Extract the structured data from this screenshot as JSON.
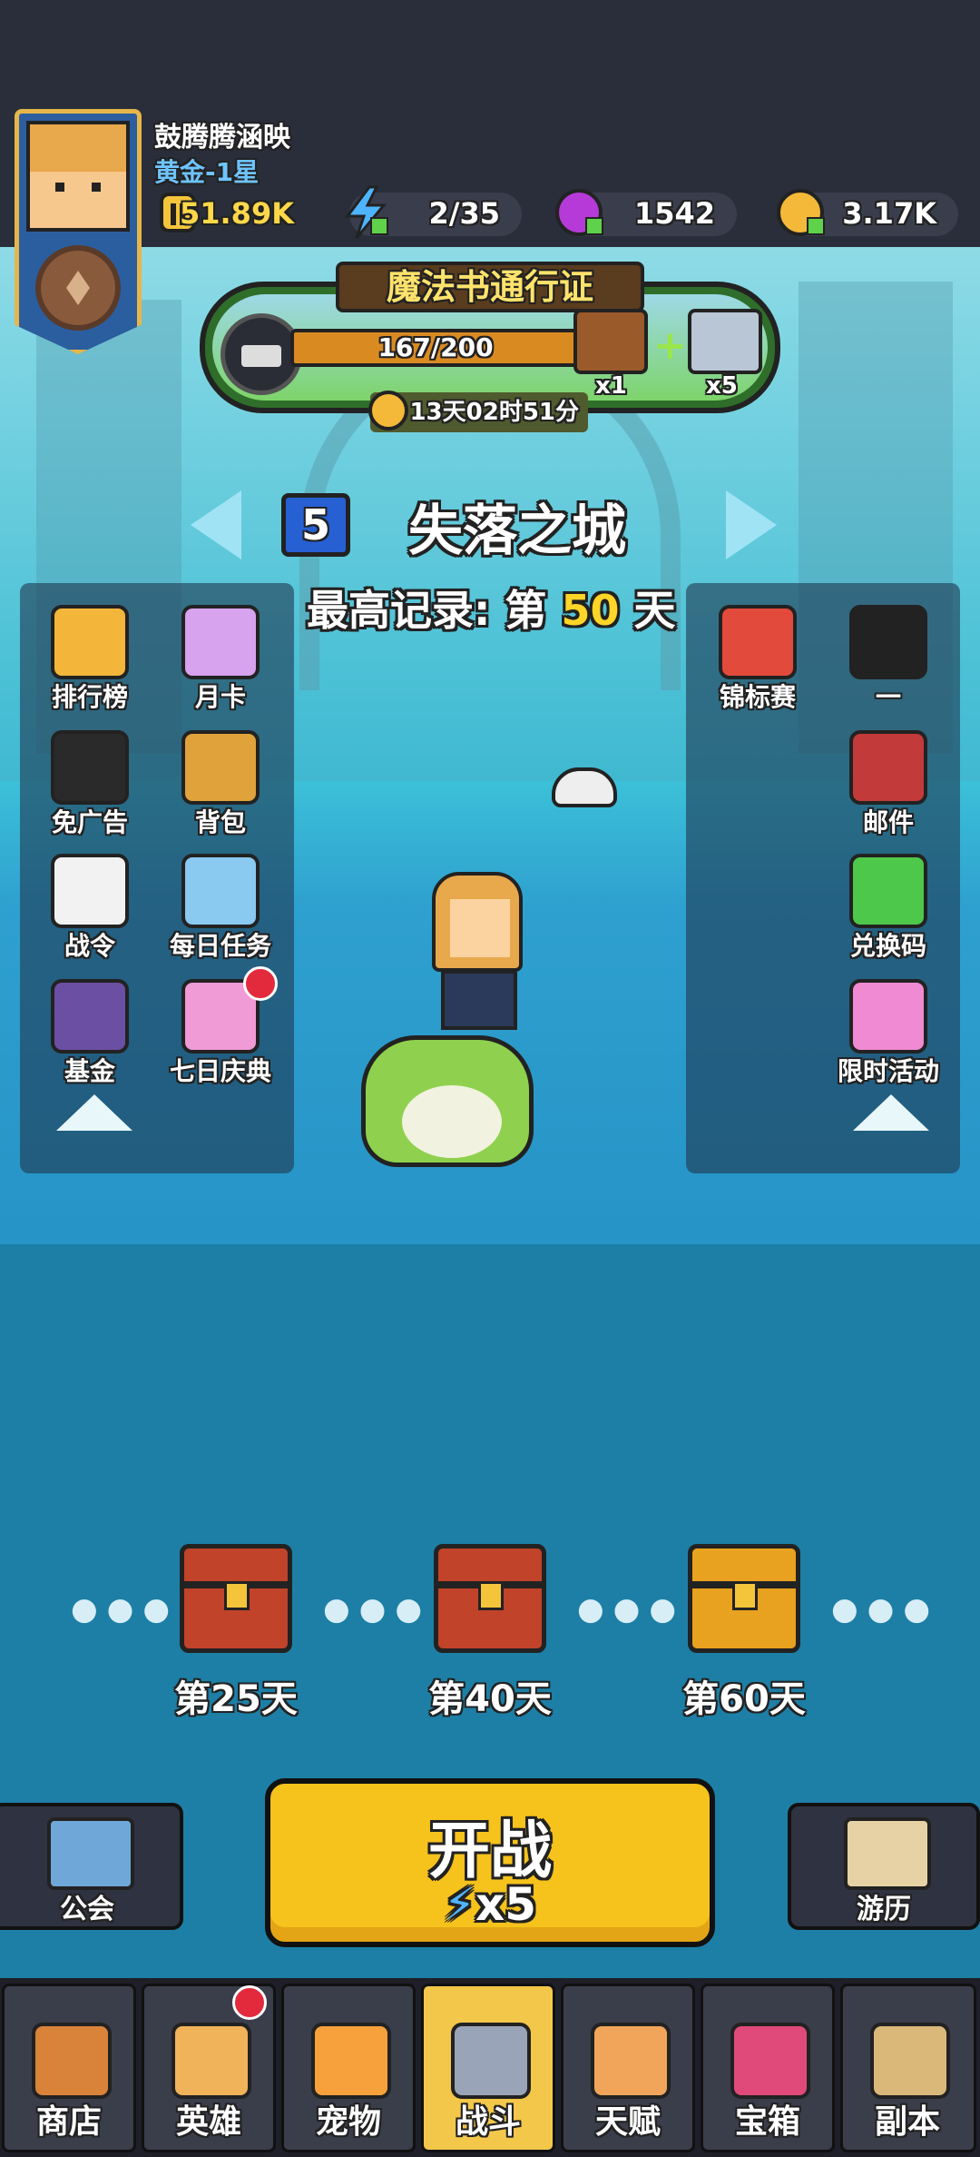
{
  "player": {
    "name": "鼓腾腾涵映",
    "rank": "黄金-1星"
  },
  "resources": [
    {
      "name": "power",
      "icon": "helmet-icon",
      "value": "51.89K",
      "color": "#ffd84a"
    },
    {
      "name": "energy",
      "icon": "lightning-icon",
      "value": "2/35",
      "color": "#ffffff"
    },
    {
      "name": "gems",
      "icon": "purple-gem-icon",
      "value": "1542",
      "color": "#ffffff"
    },
    {
      "name": "gold",
      "icon": "gold-coin-icon",
      "value": "3.17K",
      "color": "#ffffff"
    }
  ],
  "pass": {
    "title": "魔法书通行证",
    "progress": "167/200",
    "reward1_count": "x1",
    "reward2_count": "x5",
    "timer": "13天02时51分"
  },
  "stage": {
    "number": "5",
    "name": "失落之城",
    "record_prefix": "最高记录: 第",
    "record_day": "50",
    "record_suffix": "天"
  },
  "left_buttons": [
    {
      "label": "排行榜",
      "icon": "leaderboard-banner-icon",
      "color": "#f3b63a"
    },
    {
      "label": "月卡",
      "icon": "monthly-card-icon",
      "color": "#d7a2ee"
    },
    {
      "label": "免广告",
      "icon": "no-ads-icon",
      "color": "#2a2a2a"
    },
    {
      "label": "背包",
      "icon": "backpack-icon",
      "color": "#e0a23a"
    },
    {
      "label": "战令",
      "icon": "battle-order-icon",
      "color": "#f2f2f2"
    },
    {
      "label": "每日任务",
      "icon": "daily-task-icon",
      "color": "#8ac9f0"
    },
    {
      "label": "基金",
      "icon": "vault-icon",
      "color": "#6b4fa3"
    },
    {
      "label": "七日庆典",
      "icon": "gift-box-icon",
      "color": "#f09ad6"
    }
  ],
  "right_buttons": [
    {
      "label": "锦标赛",
      "icon": "mushroom-icon",
      "color": "#e24b3c"
    },
    {
      "label": "一",
      "icon": "penguin-icon",
      "color": "#222222"
    },
    {
      "label": "邮件",
      "icon": "mail-icon",
      "color": "#c23a3a"
    },
    {
      "label": "兑换码",
      "icon": "redeem-code-icon",
      "color": "#4ec84a"
    },
    {
      "label": "限时活动",
      "icon": "gacha-machine-icon",
      "color": "#f08ad2"
    }
  ],
  "milestones": [
    {
      "label": "第25天"
    },
    {
      "label": "第40天"
    },
    {
      "label": "第60天"
    }
  ],
  "actions": {
    "guild": "公会",
    "battle": "开战",
    "battle_cost": "x5",
    "adventure": "游历"
  },
  "nav": [
    {
      "label": "商店",
      "icon": "shop-icon",
      "color": "#d9823a"
    },
    {
      "label": "英雄",
      "icon": "hero-icon",
      "color": "#f0b35a"
    },
    {
      "label": "宠物",
      "icon": "pet-icon",
      "color": "#f6a13c"
    },
    {
      "label": "战斗",
      "icon": "crossed-swords-icon",
      "color": "#9aa4b8"
    },
    {
      "label": "天赋",
      "icon": "fist-icon",
      "color": "#f0a55a"
    },
    {
      "label": "宝箱",
      "icon": "treasure-chest-icon",
      "color": "#e04a7a"
    },
    {
      "label": "副本",
      "icon": "map-scroll-icon",
      "color": "#d9b87a"
    }
  ]
}
